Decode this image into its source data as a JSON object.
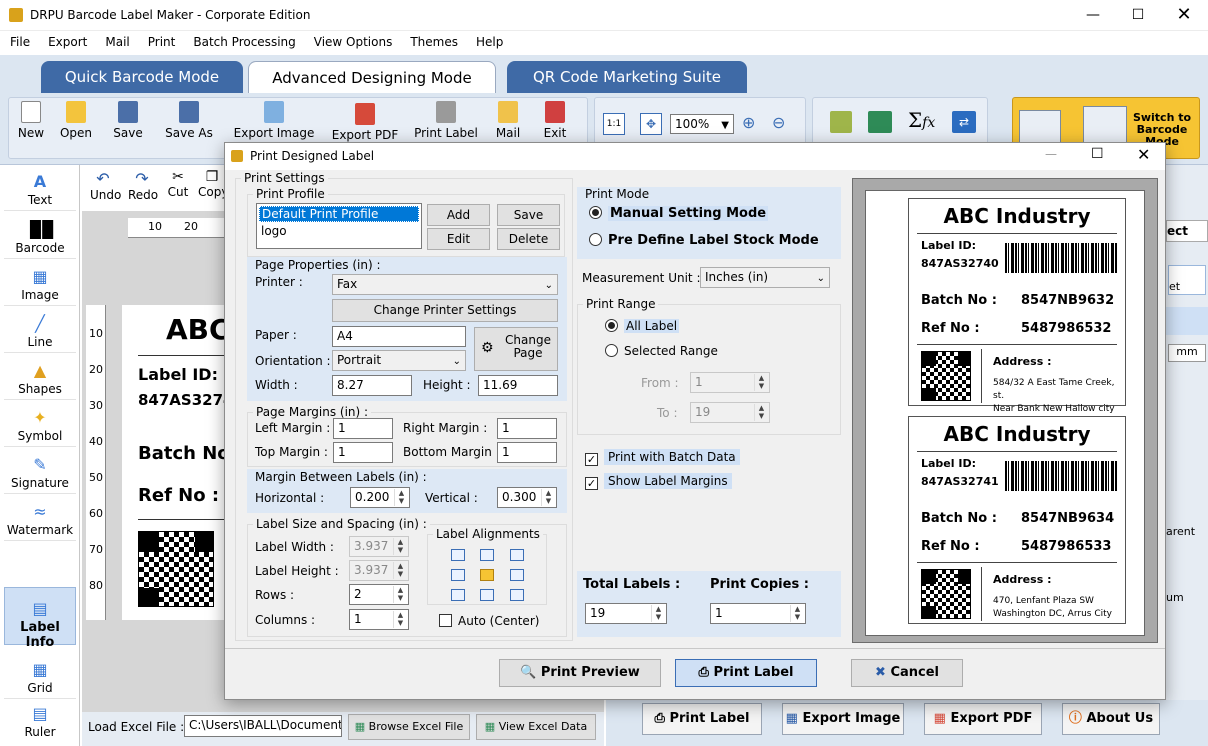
{
  "window": {
    "title": "DRPU Barcode Label Maker - Corporate Edition"
  },
  "menu": [
    "File",
    "Export",
    "Mail",
    "Print",
    "Batch Processing",
    "View Options",
    "Themes",
    "Help"
  ],
  "tabs": [
    "Quick Barcode Mode",
    "Advanced Designing Mode",
    "QR Code Marketing Suite"
  ],
  "toolbar": {
    "new": "New",
    "open": "Open",
    "save": "Save",
    "save_as": "Save As",
    "export_image": "Export Image",
    "export_pdf": "Export PDF",
    "print_label": "Print Label",
    "mail": "Mail",
    "exit": "Exit",
    "zoom": "100%",
    "switch": "Switch to Barcode Mode"
  },
  "edit_tools": {
    "undo": "Undo",
    "redo": "Redo",
    "cut": "Cut",
    "copy": "Copy"
  },
  "left_tools": [
    "Text",
    "Barcode",
    "Image",
    "Line",
    "Shapes",
    "Symbol",
    "Signature",
    "Watermark",
    "Label Info",
    "Grid",
    "Ruler"
  ],
  "ruler": {
    "top": [
      "10",
      "20"
    ],
    "left": [
      "10",
      "20",
      "30",
      "40",
      "50",
      "60",
      "70",
      "80"
    ]
  },
  "canvas_label": {
    "title": "ABC",
    "label_id": "Label ID:",
    "id_value": "847AS3274",
    "batch": "Batch No",
    "ref": "Ref No :"
  },
  "bottom_left": {
    "load_excel_label": "Load Excel File :",
    "path": "C:\\Users\\IBALL\\Document",
    "browse": "Browse Excel File",
    "view": "View Excel Data"
  },
  "bottom_right": {
    "print_label": "Print Label",
    "export_image": "Export Image",
    "export_pdf": "Export PDF",
    "about": "About Us"
  },
  "right_partial": {
    "a": "ect",
    "b": "et",
    "c": "mm",
    "d": "arent",
    "e": "um"
  },
  "dialog": {
    "title": "Print Designed Label",
    "print_settings": "Print Settings",
    "print_profile": {
      "legend": "Print Profile",
      "items": [
        "Default Print Profile",
        "logo"
      ],
      "add": "Add",
      "save": "Save",
      "edit": "Edit",
      "delete": "Delete"
    },
    "page_props": {
      "legend": "Page Properties (in) :",
      "printer_label": "Printer :",
      "printer": "Fax",
      "change_printer": "Change Printer Settings",
      "paper_label": "Paper :",
      "paper": "A4",
      "change_page": "Change Page",
      "orientation_label": "Orientation :",
      "orientation": "Portrait",
      "width_label": "Width :",
      "width": "8.27",
      "height_label": "Height :",
      "height": "11.69"
    },
    "margins": {
      "legend": "Page Margins (in) :",
      "left_label": "Left Margin :",
      "left": "1",
      "right_label": "Right Margin :",
      "right": "1",
      "top_label": "Top Margin :",
      "top": "1",
      "bottom_label": "Bottom Margin :",
      "bottom": "1"
    },
    "between": {
      "legend": "Margin Between Labels (in) :",
      "h_label": "Horizontal :",
      "h": "0.200",
      "v_label": "Vertical :",
      "v": "0.300"
    },
    "size": {
      "legend": "Label Size and Spacing (in) :",
      "lw_label": "Label Width :",
      "lw": "3.937",
      "lh_label": "Label Height :",
      "lh": "3.937",
      "rows_label": "Rows :",
      "rows": "2",
      "cols_label": "Columns :",
      "cols": "1",
      "align_legend": "Label Alignments",
      "auto": "Auto (Center)"
    },
    "print_mode": {
      "legend": "Print Mode",
      "manual": "Manual Setting Mode",
      "predefine": "Pre Define Label Stock Mode"
    },
    "measurement": {
      "label": "Measurement Unit :",
      "value": "Inches (in)"
    },
    "range": {
      "legend": "Print Range",
      "all": "All Label",
      "selected": "Selected Range",
      "from_label": "From :",
      "from": "1",
      "to_label": "To :",
      "to": "19"
    },
    "batch": "Print with Batch Data",
    "margins_chk": "Show Label Margins",
    "totals": {
      "total_label": "Total Labels :",
      "total": "19",
      "copies_label": "Print Copies :",
      "copies": "1"
    },
    "buttons": {
      "preview": "Print Preview",
      "print": "Print Label",
      "cancel": "Cancel"
    }
  },
  "preview_cards": [
    {
      "title": "ABC Industry",
      "id_label": "Label ID:",
      "id": "847AS32740",
      "batch_label": "Batch No :",
      "batch": "8547NB9632",
      "ref_label": "Ref No :",
      "ref": "5487986532",
      "addr_label": "Address :",
      "addr1": "584/32 A East Tame Creek, st.",
      "addr2": "Near Bank New Hallow city"
    },
    {
      "title": "ABC Industry",
      "id_label": "Label ID:",
      "id": "847AS32741",
      "batch_label": "Batch No :",
      "batch": "8547NB9634",
      "ref_label": "Ref No :",
      "ref": "5487986533",
      "addr_label": "Address :",
      "addr1": "470, Lenfant Plaza SW",
      "addr2": "Washington DC, Arrus City"
    }
  ]
}
